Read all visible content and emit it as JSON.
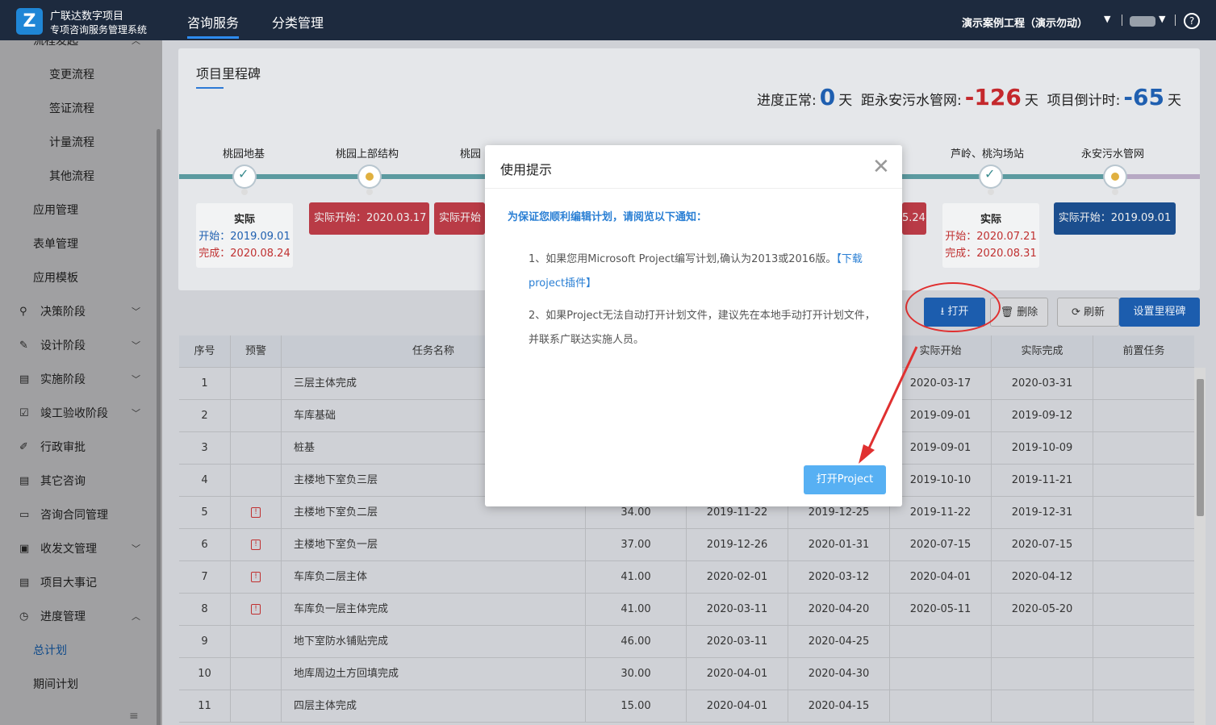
{
  "header": {
    "brand_line1": "广联达数字项目",
    "brand_line2": "专项咨询服务管理系统",
    "logo_glyph": "Z",
    "nav_tabs": [
      "咨询服务",
      "分类管理"
    ],
    "project_name": "演示案例工程（演示勿动）",
    "help_glyph": "?"
  },
  "sidebar": {
    "items": [
      {
        "label": "流程发起",
        "icon": "",
        "sub": true
      },
      {
        "label": "变更流程",
        "icon": "",
        "sub": true
      },
      {
        "label": "签证流程",
        "icon": "",
        "sub": true
      },
      {
        "label": "计量流程",
        "icon": "",
        "sub": true
      },
      {
        "label": "其他流程",
        "icon": "",
        "sub": true
      },
      {
        "label": "应用管理",
        "icon": ""
      },
      {
        "label": "表单管理",
        "icon": ""
      },
      {
        "label": "应用模板",
        "icon": ""
      },
      {
        "label": "决策阶段",
        "icon": "person-icon",
        "caret": "down"
      },
      {
        "label": "设计阶段",
        "icon": "edit-icon",
        "caret": "down"
      },
      {
        "label": "实施阶段",
        "icon": "doc-icon",
        "caret": "down"
      },
      {
        "label": "竣工验收阶段",
        "icon": "box-icon",
        "caret": "down"
      },
      {
        "label": "行政审批",
        "icon": "pen-icon"
      },
      {
        "label": "其它咨询",
        "icon": "doc-icon"
      },
      {
        "label": "咨询合同管理",
        "icon": "card-icon"
      },
      {
        "label": "收发文管理",
        "icon": "mail-icon",
        "caret": "down"
      },
      {
        "label": "项目大事记",
        "icon": "doc-icon"
      },
      {
        "label": "进度管理",
        "icon": "clock-icon",
        "caret": "up"
      },
      {
        "label": "总计划",
        "icon": "",
        "selected": true
      },
      {
        "label": "期间计划",
        "icon": ""
      }
    ],
    "collapse_glyph": "≡"
  },
  "milestones": {
    "title": "项目里程碑",
    "stat1_label": "进度正常:",
    "stat1_value": "0",
    "stat2_label": "距永安污水管网:",
    "stat2_value": "-126",
    "stat3_label": "项目倒计时:",
    "stat3_value": "-65",
    "unit": "天",
    "names": [
      "桃园地基",
      "桃园上部结构",
      "桃园",
      "芦岭、桃沟场站",
      "永安污水管网"
    ],
    "card1": {
      "head": "实际",
      "start": "开始：2019.09.01",
      "end": "完成：2020.08.24"
    },
    "card2": "实际开始：2020.03.17",
    "card3": "实际开始",
    "card4": "5.24",
    "card5": {
      "head": "实际",
      "start": "开始：2020.07.21",
      "end": "完成：2020.08.31"
    },
    "card6": "实际开始：2019.09.01"
  },
  "toolbar": {
    "open": "⭳ 打开",
    "delete": "🗑 删除",
    "refresh": "⟳ 刷新",
    "set_milestone": "设置里程碑"
  },
  "table": {
    "headers": [
      "序号",
      "预警",
      "任务名称",
      "实际开始",
      "实际完成",
      "前置任务"
    ],
    "rows": [
      {
        "no": "1",
        "warn": false,
        "name": "三层主体完成",
        "dur": "",
        "ps": "",
        "pe": "",
        "as": "2020-03-17",
        "ae": "2020-03-31"
      },
      {
        "no": "2",
        "warn": false,
        "name": "车库基础",
        "dur": "",
        "ps": "",
        "pe": "",
        "as": "2019-09-01",
        "ae": "2019-09-12"
      },
      {
        "no": "3",
        "warn": false,
        "name": "桩基",
        "dur": "",
        "ps": "",
        "pe": "",
        "as": "2019-09-01",
        "ae": "2019-10-09"
      },
      {
        "no": "4",
        "warn": false,
        "name": "主楼地下室负三层",
        "dur": "",
        "ps": "",
        "pe": "",
        "as": "2019-10-10",
        "ae": "2019-11-21"
      },
      {
        "no": "5",
        "warn": true,
        "name": "主楼地下室负二层",
        "dur": "34.00",
        "ps": "2019-11-22",
        "pe": "2019-12-25",
        "as": "2019-11-22",
        "ae": "2019-12-31"
      },
      {
        "no": "6",
        "warn": true,
        "name": "主楼地下室负一层",
        "dur": "37.00",
        "ps": "2019-12-26",
        "pe": "2020-01-31",
        "as": "2020-07-15",
        "ae": "2020-07-15"
      },
      {
        "no": "7",
        "warn": true,
        "name": "车库负二层主体",
        "dur": "41.00",
        "ps": "2020-02-01",
        "pe": "2020-03-12",
        "as": "2020-04-01",
        "ae": "2020-04-12"
      },
      {
        "no": "8",
        "warn": true,
        "name": "车库负一层主体完成",
        "dur": "41.00",
        "ps": "2020-03-11",
        "pe": "2020-04-20",
        "as": "2020-05-11",
        "ae": "2020-05-20"
      },
      {
        "no": "9",
        "warn": false,
        "name": "地下室防水铺贴完成",
        "dur": "46.00",
        "ps": "2020-03-11",
        "pe": "2020-04-25",
        "as": "",
        "ae": ""
      },
      {
        "no": "10",
        "warn": false,
        "name": "地库周边土方回填完成",
        "dur": "30.00",
        "ps": "2020-04-01",
        "pe": "2020-04-30",
        "as": "",
        "ae": ""
      },
      {
        "no": "11",
        "warn": false,
        "name": "四层主体完成",
        "dur": "15.00",
        "ps": "2020-04-01",
        "pe": "2020-04-15",
        "as": "",
        "ae": ""
      }
    ]
  },
  "modal": {
    "title": "使用提示",
    "lead": "为保证您顺利编辑计划，请阅览以下通知：",
    "p1": "1、如果您用Microsoft Project编写计划,确认为2013或2016版。",
    "p1_link": "【下载project插件】",
    "p2": "2、如果Project无法自动打开计划文件，建议先在本地手动打开计划文件，并联系广联达实施人员。",
    "button": "打开Project",
    "close_glyph": "✕"
  },
  "colors": {
    "accent": "#2d8cf0",
    "danger": "#c4282c",
    "annotation": "#e03030"
  }
}
